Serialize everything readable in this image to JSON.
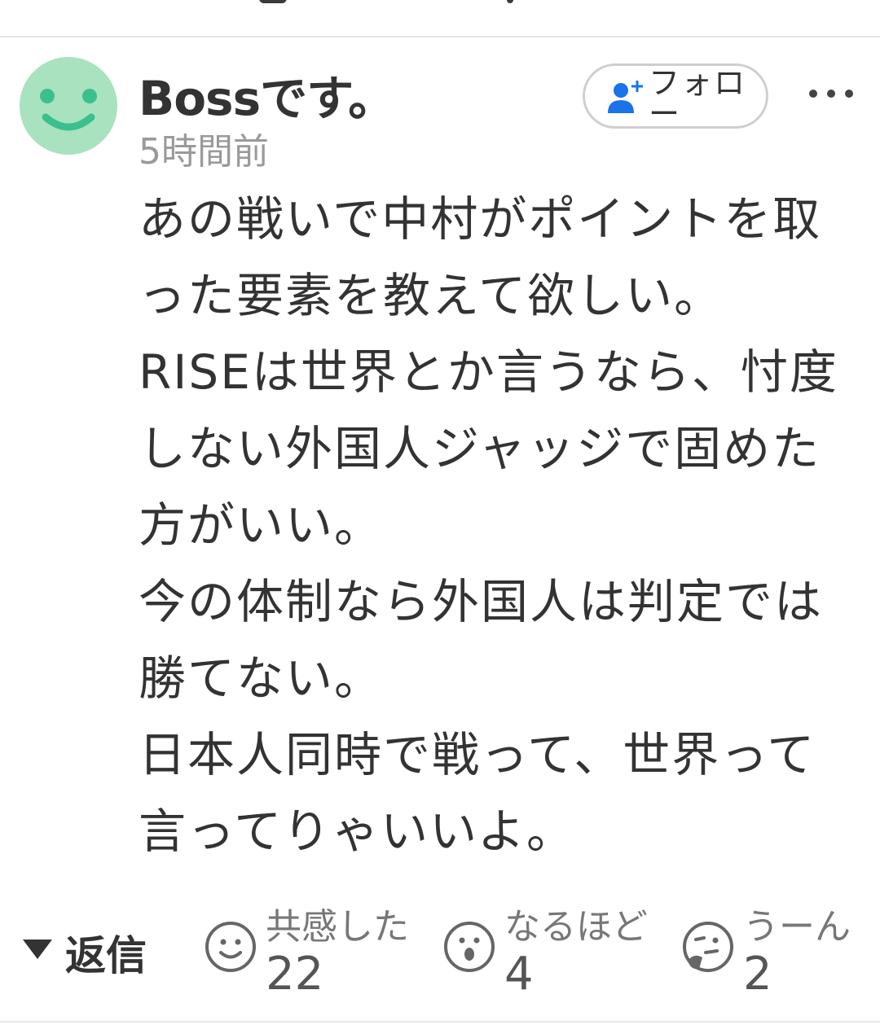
{
  "comment": {
    "username": "Bossです。",
    "time_ago": "5時間前",
    "follow_label": "フォロー",
    "more_icon": "more-horizontal-icon",
    "avatar_icon": "smiley-face-icon",
    "body_lines": [
      "あの戦いで中村がポイントを取った要素を教えて欲しい。",
      "RISEは世界とか言うなら、忖度しない外国人ジャッジで固めた方がいい。",
      "今の体制なら外国人は判定では勝てない。",
      "日本人同時で戦って、世界って言ってりゃいいよ。"
    ]
  },
  "actions": {
    "reply_label": "返信",
    "reactions": [
      {
        "label": "共感した",
        "count": "22",
        "icon": "smile-reaction-icon"
      },
      {
        "label": "なるほど",
        "count": "4",
        "icon": "surprised-reaction-icon"
      },
      {
        "label": "うーん",
        "count": "2",
        "icon": "thinking-reaction-icon"
      }
    ]
  },
  "colors": {
    "avatar_bg": "#a9e2bf",
    "avatar_face": "#3bbf8f",
    "follow_icon": "#1a73e8",
    "text": "#333333",
    "muted": "#9a9a9a"
  }
}
